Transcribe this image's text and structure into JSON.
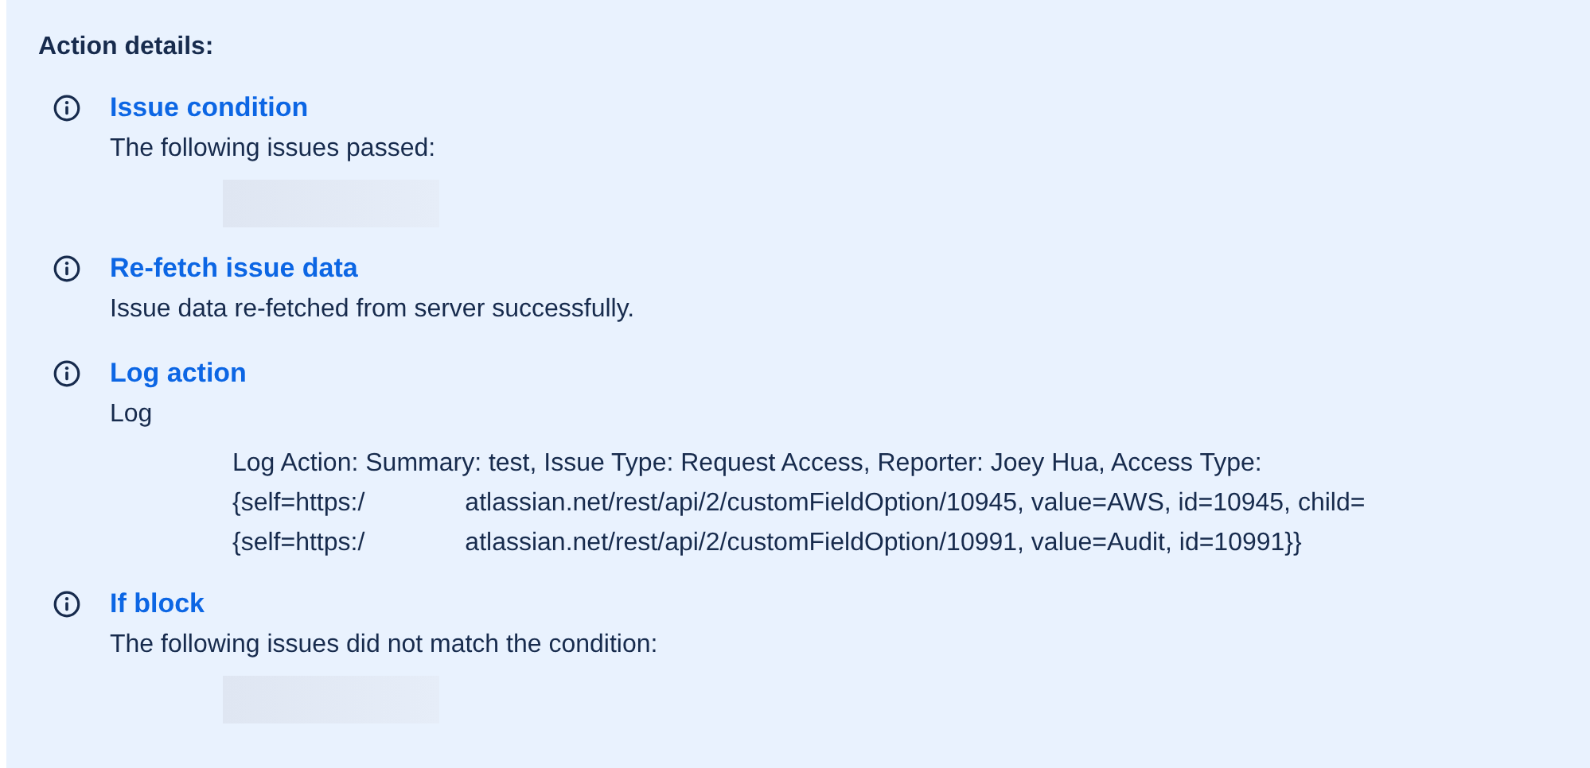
{
  "panel": {
    "heading": "Action details:",
    "items": [
      {
        "title": "Issue condition",
        "description": "The following issues passed:",
        "redacted": true
      },
      {
        "title": "Re-fetch issue data",
        "description": "Issue data re-fetched from server successfully.",
        "redacted": false
      },
      {
        "title": "Log action",
        "description": "Log",
        "log_lines": [
          [
            "Log Action: Summary: test, Issue Type: Request Access, Reporter: Joey Hua, Access Type:"
          ],
          [
            "{self=https:/",
            "atlassian.net/rest/api/2/customFieldOption/10945, value=AWS, id=10945, child="
          ],
          [
            "{self=https:/",
            "atlassian.net/rest/api/2/customFieldOption/10991, value=Audit, id=10991}}"
          ]
        ],
        "redacted": false
      },
      {
        "title": "If block",
        "description": "The following issues did not match the condition:",
        "redacted": true
      }
    ]
  }
}
